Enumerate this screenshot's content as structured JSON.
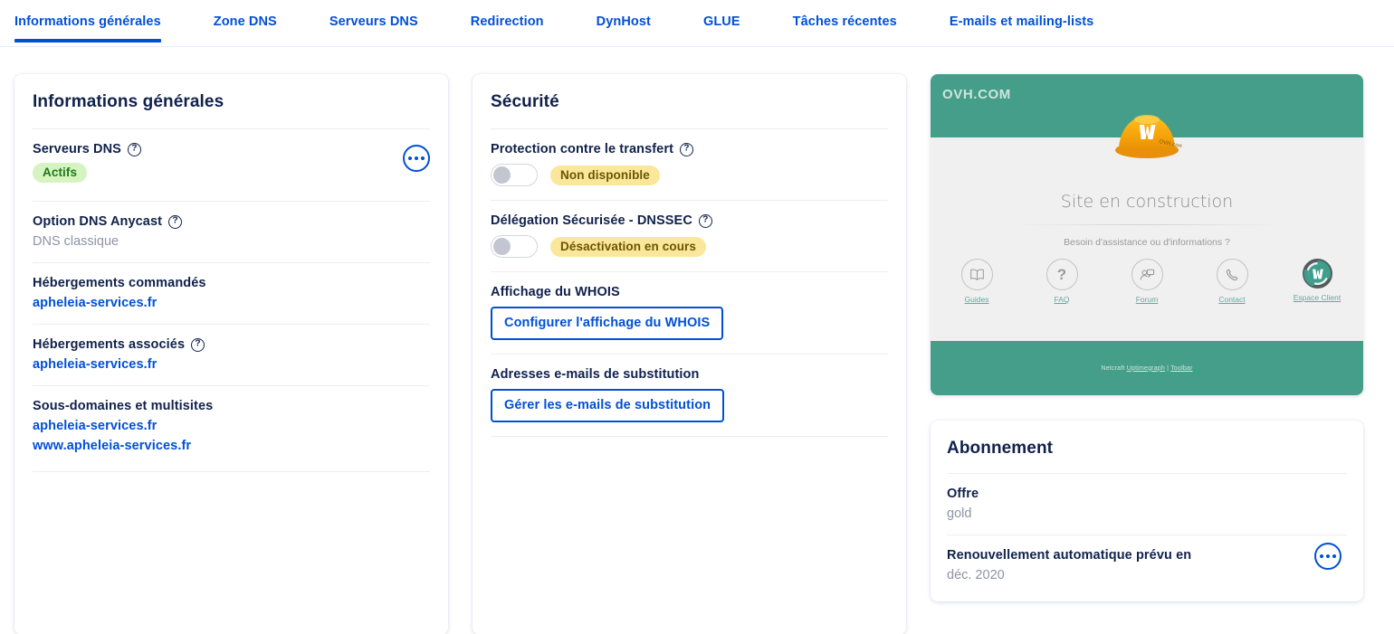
{
  "tabs": [
    {
      "label": "Informations générales",
      "active": true
    },
    {
      "label": "Zone DNS",
      "active": false
    },
    {
      "label": "Serveurs DNS",
      "active": false
    },
    {
      "label": "Redirection",
      "active": false
    },
    {
      "label": "DynHost",
      "active": false
    },
    {
      "label": "GLUE",
      "active": false
    },
    {
      "label": "Tâches récentes",
      "active": false
    },
    {
      "label": "E-mails et mailing-lists",
      "active": false
    }
  ],
  "general_info": {
    "title": "Informations générales",
    "dns_servers": {
      "label": "Serveurs DNS",
      "status_badge": "Actifs"
    },
    "anycast": {
      "label": "Option DNS Anycast",
      "value": "DNS classique"
    },
    "hosting_ordered": {
      "label": "Hébergements commandés",
      "links": [
        "apheleia-services.fr"
      ]
    },
    "hosting_associated": {
      "label": "Hébergements associés",
      "links": [
        "apheleia-services.fr"
      ]
    },
    "subdomains": {
      "label": "Sous-domaines et multisites",
      "links": [
        "apheleia-services.fr",
        "www.apheleia-services.fr"
      ]
    }
  },
  "security": {
    "title": "Sécurité",
    "transfer_protection": {
      "label": "Protection contre le transfert",
      "status_badge": "Non disponible",
      "toggle_on": false
    },
    "dnssec": {
      "label": "Délégation Sécurisée - DNSSEC",
      "status_badge": "Désactivation en cours",
      "toggle_on": false
    },
    "whois": {
      "label": "Affichage du WHOIS",
      "button": "Configurer l'affichage du WHOIS"
    },
    "substitution_emails": {
      "label": "Adresses e-mails de substitution",
      "button": "Gérer les e-mails de substitution"
    }
  },
  "preview": {
    "logo": "OVH.COM",
    "headline": "Site en construction",
    "assistance": "Besoin d'assistance ou d'informations ?",
    "links": [
      {
        "label": "Guides",
        "icon": "book-icon"
      },
      {
        "label": "FAQ",
        "icon": "question-mark-icon"
      },
      {
        "label": "Forum",
        "icon": "forum-icon"
      },
      {
        "label": "Contact",
        "icon": "phone-icon"
      },
      {
        "label": "Espace Client",
        "icon": "ovh-check-icon"
      }
    ],
    "footer_prefix": "Netcraft ",
    "footer_link1": "Uptimegraph",
    "footer_sep": " | ",
    "footer_link2": "Toolbar"
  },
  "subscription": {
    "title": "Abonnement",
    "offer": {
      "label": "Offre",
      "value": "gold"
    },
    "renewal": {
      "label": "Renouvellement automatique prévu en",
      "value": "déc. 2020"
    }
  },
  "colors": {
    "accent_blue": "#0050d7",
    "navy": "#10214b",
    "badge_green_bg": "#d6f3c2",
    "badge_green_text": "#1d7a14",
    "badge_yellow_bg": "#fbe79b",
    "badge_yellow_text": "#6b5500",
    "preview_teal": "#459e8a",
    "muted": "#8e93a6"
  },
  "icons": {
    "help": "?",
    "kebab": "ellipsis-horizontal-icon"
  }
}
